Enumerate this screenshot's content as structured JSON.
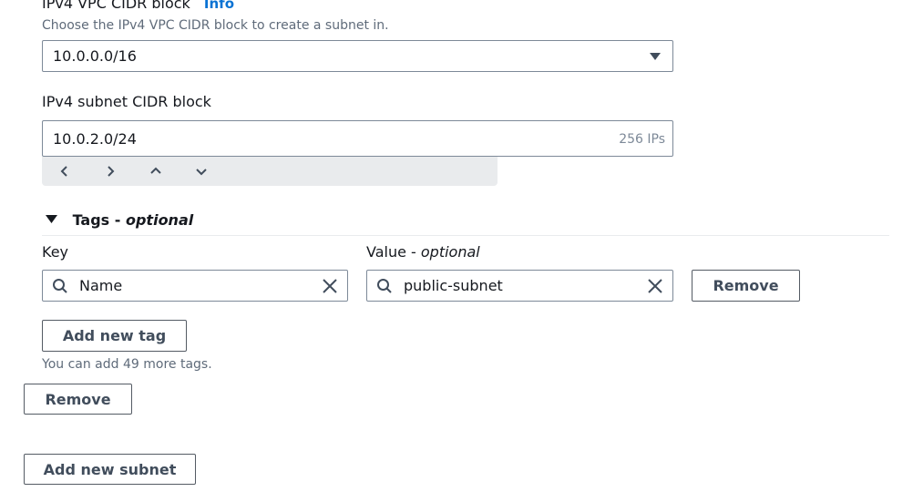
{
  "vpc_cidr": {
    "label": "IPv4 VPC CIDR block",
    "info_link": "Info",
    "description": "Choose the IPv4 VPC CIDR block to create a subnet in.",
    "selected_value": "10.0.0.0/16"
  },
  "subnet_cidr": {
    "label": "IPv4 subnet CIDR block",
    "value": "10.0.2.0/24",
    "ip_count": "256 IPs"
  },
  "tags": {
    "header_label": "Tags - ",
    "header_optional": "optional",
    "key_label": "Key",
    "value_label": "Value - ",
    "value_optional": "optional",
    "rows": [
      {
        "key": "Name",
        "value": "public-subnet",
        "remove_label": "Remove"
      }
    ],
    "add_tag_label": "Add new tag",
    "limit_text": "You can add 49 more tags."
  },
  "subnet_remove_label": "Remove",
  "add_subnet_label": "Add new subnet",
  "colors": {
    "link": "#0972d3",
    "border": "#7d8998",
    "button_border": "#545b64",
    "stepper_bg": "#e9ebed"
  }
}
